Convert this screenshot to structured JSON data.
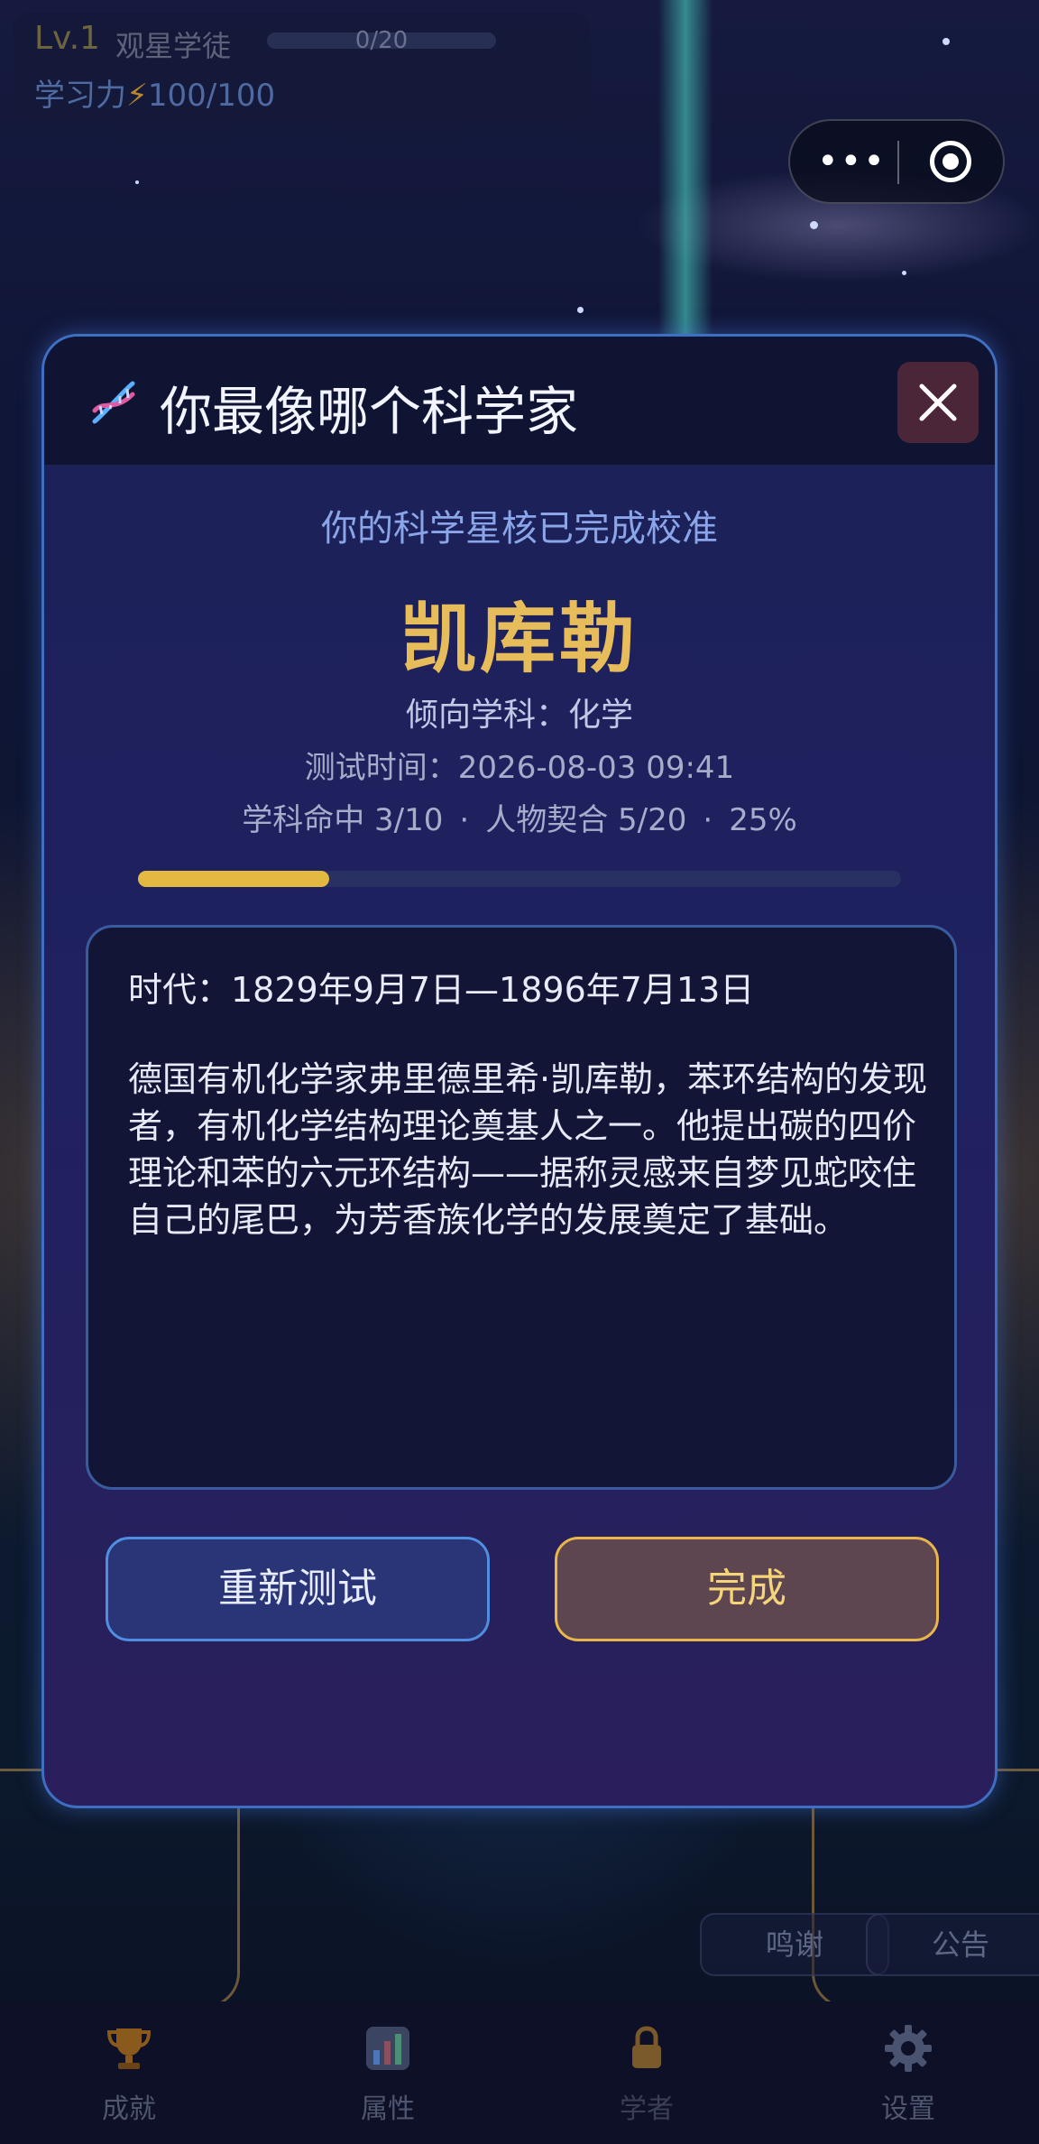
{
  "status": {
    "level": "Lv.1",
    "level_name": "观星学徒",
    "xp_text": "0/20",
    "power_label": "学习力",
    "power_value": "100/100"
  },
  "capsule": {
    "more_icon": "more-dots-icon",
    "close_icon": "target-circle-icon"
  },
  "modal": {
    "title": "你最像哪个科学家",
    "title_icon": "dna-icon",
    "close_icon": "close-icon",
    "subtitle": "你的科学星核已完成校准",
    "scientist_name": "凯库勒",
    "subject_line": "倾向学科：化学",
    "test_time": "测试时间：2026-08-03 09:41",
    "stats": {
      "subject_hit": "学科命中 3/10",
      "person_match": "人物契合 5/20",
      "percent": "25%",
      "separator": "·"
    },
    "progress": 0.25,
    "era": "时代：1829年9月7日—1896年7月13日",
    "description": "德国有机化学家弗里德里希·凯库勒，苯环结构的发现者，有机化学结构理论奠基人之一。他提出碳的四价理论和苯的六元环结构——据称灵感来自梦见蛇咬住自己的尾巴，为芳香族化学的发展奠定了基础。",
    "retest_label": "重新测试",
    "done_label": "完成"
  },
  "side_tags": {
    "thanks": "鸣谢",
    "notice": "公告"
  },
  "tabbar": [
    {
      "label": "成就",
      "icon": "trophy-icon"
    },
    {
      "label": "属性",
      "icon": "bar-chart-icon"
    },
    {
      "label": "学者",
      "icon": "lock-icon"
    },
    {
      "label": "设置",
      "icon": "gear-icon"
    }
  ],
  "colors": {
    "accent_gold": "#e7bd5c",
    "accent_blue": "#4f8ee0",
    "modal_border": "#3f6fc2"
  }
}
